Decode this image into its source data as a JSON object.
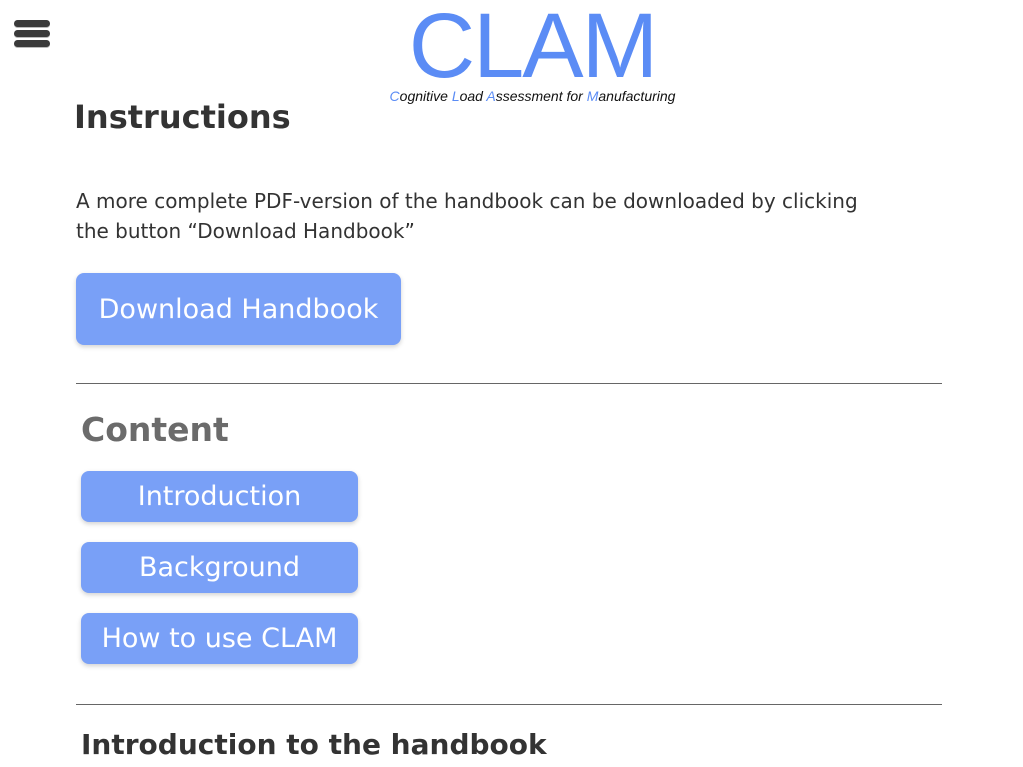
{
  "header": {
    "menu_icon": "hamburger-icon",
    "logo_text": "CLAM",
    "logo_subtitle": [
      {
        "initial": "C",
        "rest": "ognitive "
      },
      {
        "initial": "L",
        "rest": "oad "
      },
      {
        "initial": "A",
        "rest": "ssessment for "
      },
      {
        "initial": "M",
        "rest": "anufacturing"
      }
    ],
    "brand_color": "#5b8cf5"
  },
  "instructions": {
    "title": "Instructions",
    "description": "A more complete PDF-version of the handbook can be downloaded by clicking the button “Download Handbook”",
    "download_label": "Download Handbook",
    "button_color": "#79a0f7"
  },
  "content": {
    "title": "Content",
    "items": [
      {
        "label": "Introduction"
      },
      {
        "label": "Background"
      },
      {
        "label": "How to use CLAM"
      }
    ]
  },
  "section": {
    "title": "Introduction to the handbook"
  }
}
